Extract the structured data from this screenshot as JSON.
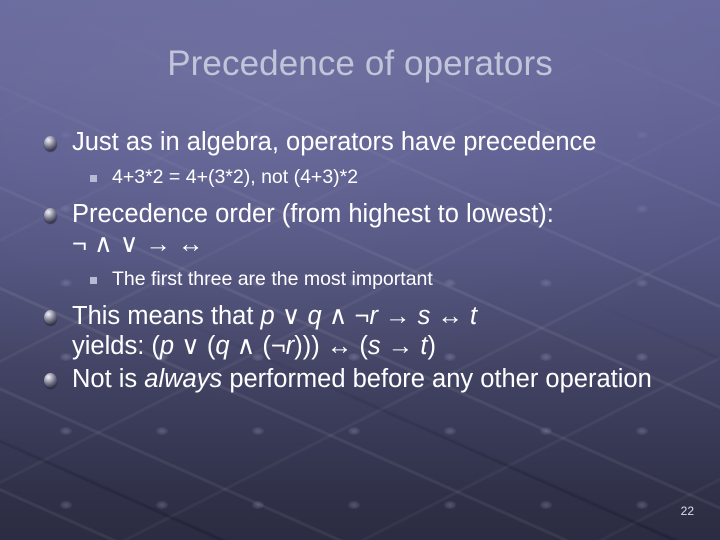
{
  "slide": {
    "title": "Precedence of operators",
    "page_number": "22",
    "title_color": "#c3c4da",
    "body_color": "#ffffff",
    "background_top_color": "#6a6b9e",
    "background_bottom_color": "#2b2c42",
    "bullet_marker_icon": "sphere-bullet-icon",
    "sub_bullet_marker_icon": "square-bullet-icon",
    "bullets": [
      {
        "level": 1,
        "align": "justify",
        "text": "Just as in algebra, operators have precedence"
      },
      {
        "level": 2,
        "text": "4+3*2 = 4+(3*2), not (4+3)*2"
      },
      {
        "level": 1,
        "text": "Precedence order (from highest to lowest):",
        "line2": "¬ ∧ ∨ → ↔"
      },
      {
        "level": 2,
        "text": "The first three are the most important"
      },
      {
        "level": 1,
        "line1_a": "This means that ",
        "line1_p": "p",
        "line1_b": " ∨ ",
        "line1_q": "q",
        "line1_c": " ∧ ¬",
        "line1_r": "r",
        "line1_d": " → ",
        "line1_s": "s",
        "line1_e": " ↔ ",
        "line1_t": "t",
        "line2_a": "yields: (",
        "line2_p": "p",
        "line2_b": " ∨ (",
        "line2_q": "q",
        "line2_c": " ∧ (¬",
        "line2_r": "r",
        "line2_d": "))) ↔ (",
        "line2_s": "s",
        "line2_e": " → ",
        "line2_t": "t",
        "line2_f": ")"
      },
      {
        "level": 1,
        "text_a": "Not is ",
        "text_em": "always",
        "text_b": " performed before any other operation"
      }
    ]
  }
}
